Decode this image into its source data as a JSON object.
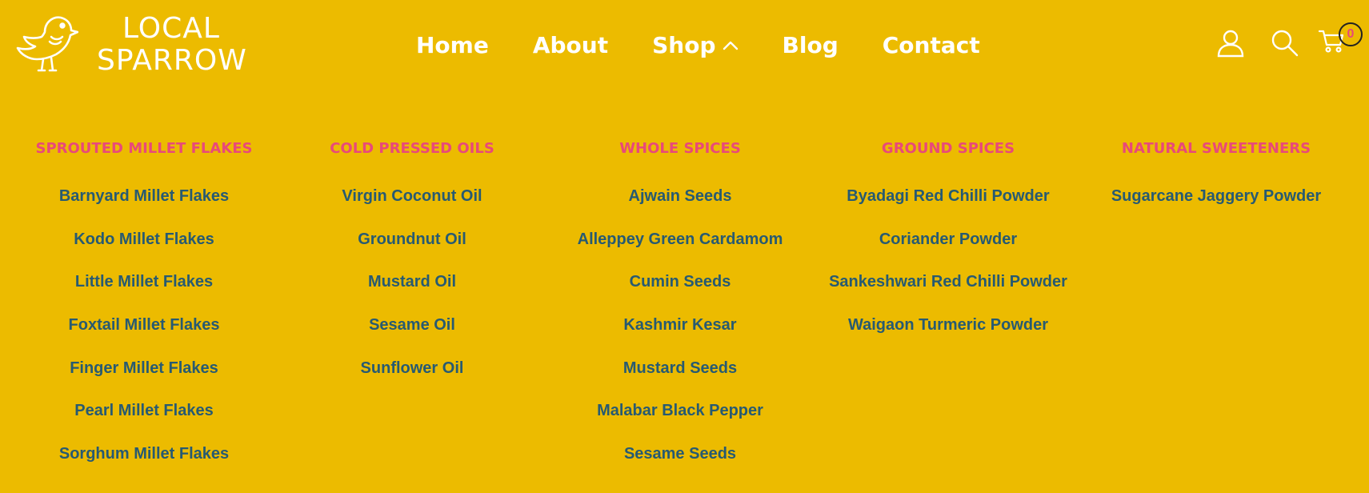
{
  "brand": {
    "line1": "LOCAL",
    "line2": "SPARROW",
    "logo_icon": "sparrow-bird-icon"
  },
  "nav": {
    "items": [
      {
        "label": "Home"
      },
      {
        "label": "About"
      },
      {
        "label": "Shop",
        "expanded": true,
        "icon": "chevron-up-icon"
      },
      {
        "label": "Blog"
      },
      {
        "label": "Contact"
      }
    ]
  },
  "header_icons": {
    "account": "user-icon",
    "search": "search-icon",
    "cart": "cart-icon",
    "cart_count": "0"
  },
  "colors": {
    "background": "#ecbb00",
    "category_title": "#e8497a",
    "link": "#275a72",
    "nav_text": "#ffffff"
  },
  "mega_menu": {
    "columns": [
      {
        "title": "SPROUTED MILLET FLAKES",
        "links": [
          "Barnyard Millet Flakes",
          "Kodo Millet Flakes",
          "Little Millet Flakes",
          "Foxtail Millet Flakes",
          "Finger Millet Flakes",
          "Pearl Millet Flakes",
          "Sorghum Millet Flakes"
        ]
      },
      {
        "title": "COLD PRESSED OILS",
        "links": [
          "Virgin Coconut Oil",
          "Groundnut Oil",
          "Mustard Oil",
          "Sesame Oil",
          "Sunflower Oil"
        ]
      },
      {
        "title": "WHOLE SPICES",
        "links": [
          "Ajwain Seeds",
          "Alleppey Green Cardamom",
          "Cumin Seeds",
          "Kashmir Kesar",
          "Mustard Seeds",
          "Malabar Black Pepper",
          "Sesame Seeds"
        ]
      },
      {
        "title": "GROUND SPICES",
        "links": [
          "Byadagi Red Chilli Powder",
          "Coriander Powder",
          "Sankeshwari Red Chilli Powder",
          "Waigaon Turmeric Powder"
        ]
      },
      {
        "title": "NATURAL SWEETENERS",
        "links": [
          "Sugarcane Jaggery Powder"
        ]
      }
    ]
  }
}
